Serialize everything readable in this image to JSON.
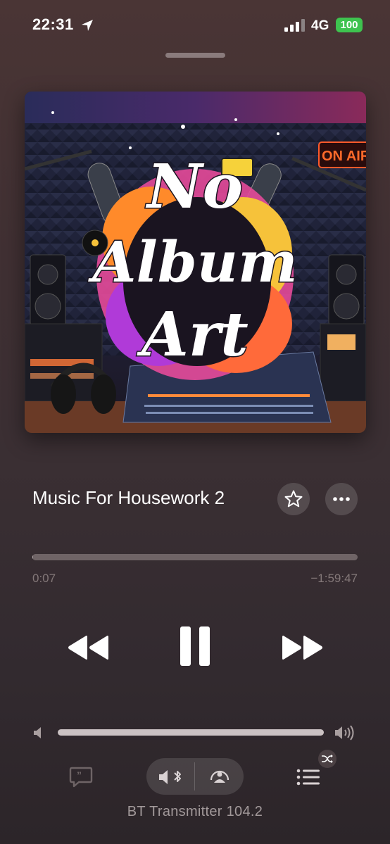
{
  "status_bar": {
    "time": "22:31",
    "network": "4G",
    "battery": "100"
  },
  "now_playing": {
    "artwork_text": [
      "No",
      "Album",
      "Art"
    ],
    "artwork_sign": "ON AIR",
    "title": "Music For Housework 2",
    "elapsed": "0:07",
    "remaining": "−1:59:47",
    "progress": 0.001,
    "volume": 1.0
  },
  "output": {
    "device_name": "BT Transmitter 104.2"
  },
  "colors": {
    "battery_green": "#3ec34f",
    "background": "#3a2f33"
  },
  "icons": {
    "location": "location-arrow-icon",
    "favorite": "star-icon",
    "more": "ellipsis-icon",
    "lyrics": "lyrics-icon",
    "audio_route": "speaker-bluetooth-icon",
    "airplay": "airplay-icon",
    "queue": "queue-icon",
    "shuffle": "shuffle-icon"
  }
}
